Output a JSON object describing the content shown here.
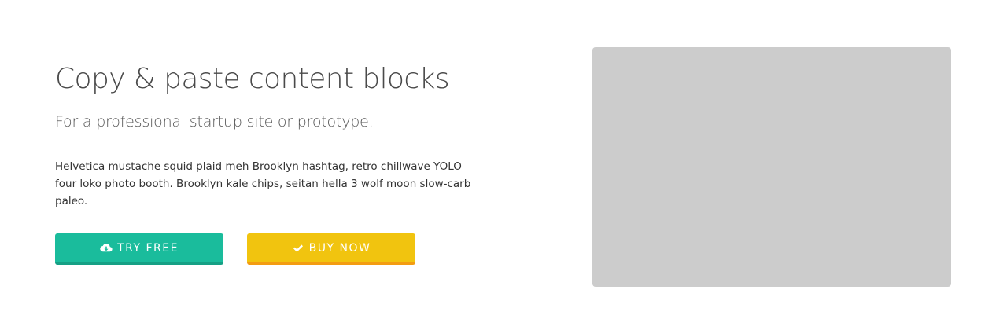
{
  "hero": {
    "title": "Copy & paste content blocks",
    "subtitle": "For a professional startup site or prototype.",
    "body": "Helvetica mustache squid plaid meh Brooklyn hashtag, retro chillwave YOLO four loko photo booth. Brooklyn kale chips, seitan hella 3 wolf moon slow-carb paleo.",
    "buttons": {
      "try_free": {
        "label": "TRY FREE",
        "icon": "cloud-download-icon",
        "color": "#1abc9c"
      },
      "buy_now": {
        "label": "BUY NOW",
        "icon": "check-icon",
        "color": "#f1c40f"
      }
    },
    "image_placeholder_color": "#cccccc"
  }
}
